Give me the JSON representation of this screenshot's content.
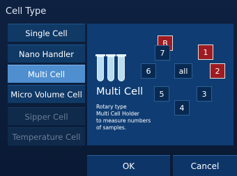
{
  "dialog": {
    "title": "Cell Type"
  },
  "cell_types": [
    {
      "label": "Single Cell",
      "state": "normal"
    },
    {
      "label": "Nano Handler",
      "state": "normal"
    },
    {
      "label": "Multi Cell",
      "state": "selected"
    },
    {
      "label": "Micro Volume Cell",
      "state": "normal"
    },
    {
      "label": "Sipper Cell",
      "state": "disabled"
    },
    {
      "label": "Temperature Cell",
      "state": "disabled"
    }
  ],
  "panel": {
    "title": "Multi Cell",
    "description": "Rotary type\nMulti Cell Holder\nto measure numbers\nof samples.",
    "icon": "test-tubes-icon"
  },
  "cell_positions": [
    {
      "label": "B",
      "active": true
    },
    {
      "label": "1",
      "active": true
    },
    {
      "label": "2",
      "active": true
    },
    {
      "label": "3",
      "active": false
    },
    {
      "label": "4",
      "active": false
    },
    {
      "label": "5",
      "active": false
    },
    {
      "label": "6",
      "active": false
    },
    {
      "label": "7",
      "active": false
    },
    {
      "label": "all",
      "active": false
    }
  ],
  "buttons": {
    "ok": "OK",
    "cancel": "Cancel"
  },
  "colors": {
    "active_slot": "#9e1b22",
    "selected_item": "#4f8fd0",
    "panel": "#0f3d73"
  }
}
